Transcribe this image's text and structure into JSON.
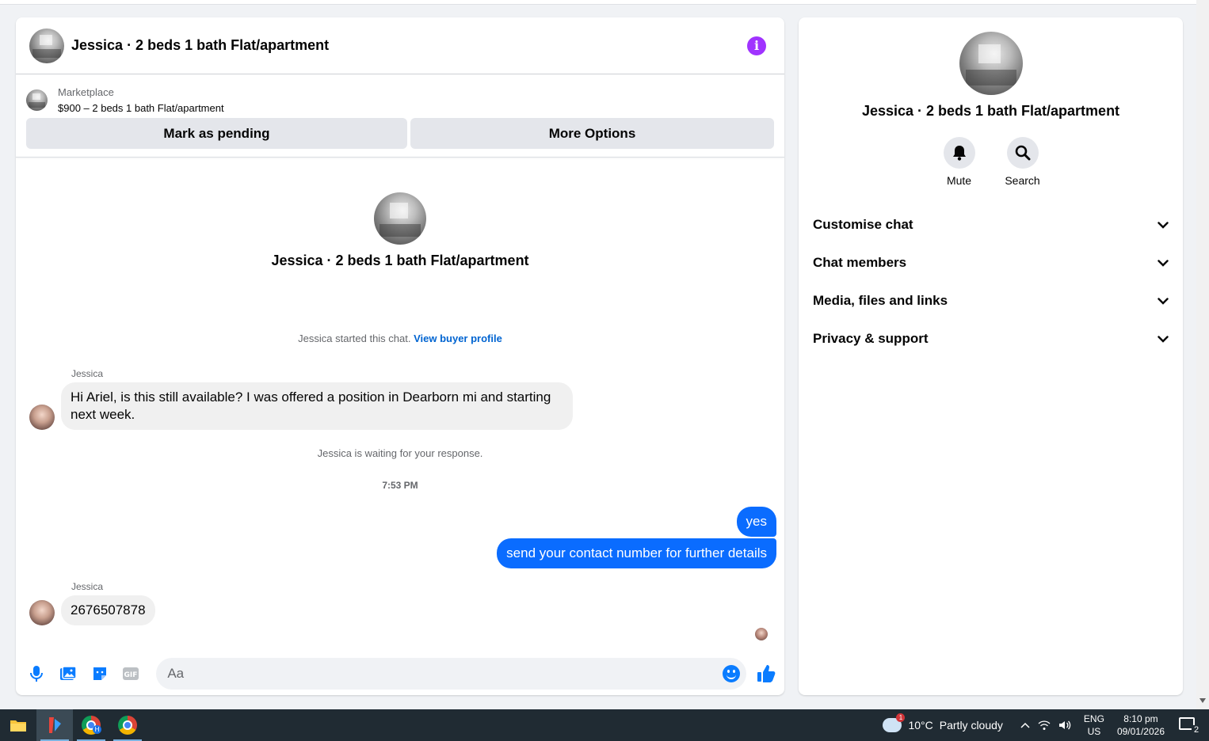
{
  "chat": {
    "title": "Jessica · 2 beds 1 bath Flat/apartment",
    "info_icon": "i",
    "marketplace_label": "Marketplace",
    "listing": "$900 – 2 beds 1 bath Flat/apartment",
    "mark_pending": "Mark as pending",
    "more_options": "More Options",
    "intro_title": "Jessica · 2 beds 1 bath Flat/apartment",
    "started_text": "Jessica started this chat. ",
    "view_buyer_profile": "View buyer profile",
    "messages": [
      {
        "sender": "Jessica",
        "text": "Hi Ariel, is this still available? I was offered a position in Dearborn mi and starting next week."
      },
      {
        "system": "Jessica is waiting for your response."
      },
      {
        "timestamp": "7:53 PM"
      },
      {
        "out": "yes"
      },
      {
        "out": "send your contact number for further details"
      },
      {
        "sender": "Jessica",
        "text": "2676507878"
      }
    ],
    "composer_placeholder": "Aa"
  },
  "side": {
    "title": "Jessica · 2 beds 1 bath Flat/apartment",
    "mute": "Mute",
    "search": "Search",
    "items": [
      "Customise chat",
      "Chat members",
      "Media, files and links",
      "Privacy & support"
    ]
  },
  "taskbar": {
    "weather_temp": "10°C",
    "weather_text": "Partly cloudy",
    "weather_badge": "1",
    "lang_top": "ENG",
    "lang_bottom": "US",
    "time": "8:10 pm",
    "date": "09/01/2026",
    "notifications": "2",
    "chrome_badge": "H"
  },
  "colors": {
    "accent": "#0a6cff",
    "info": "#a033ff",
    "link": "#0064d1",
    "taskbar": "#202b33"
  }
}
